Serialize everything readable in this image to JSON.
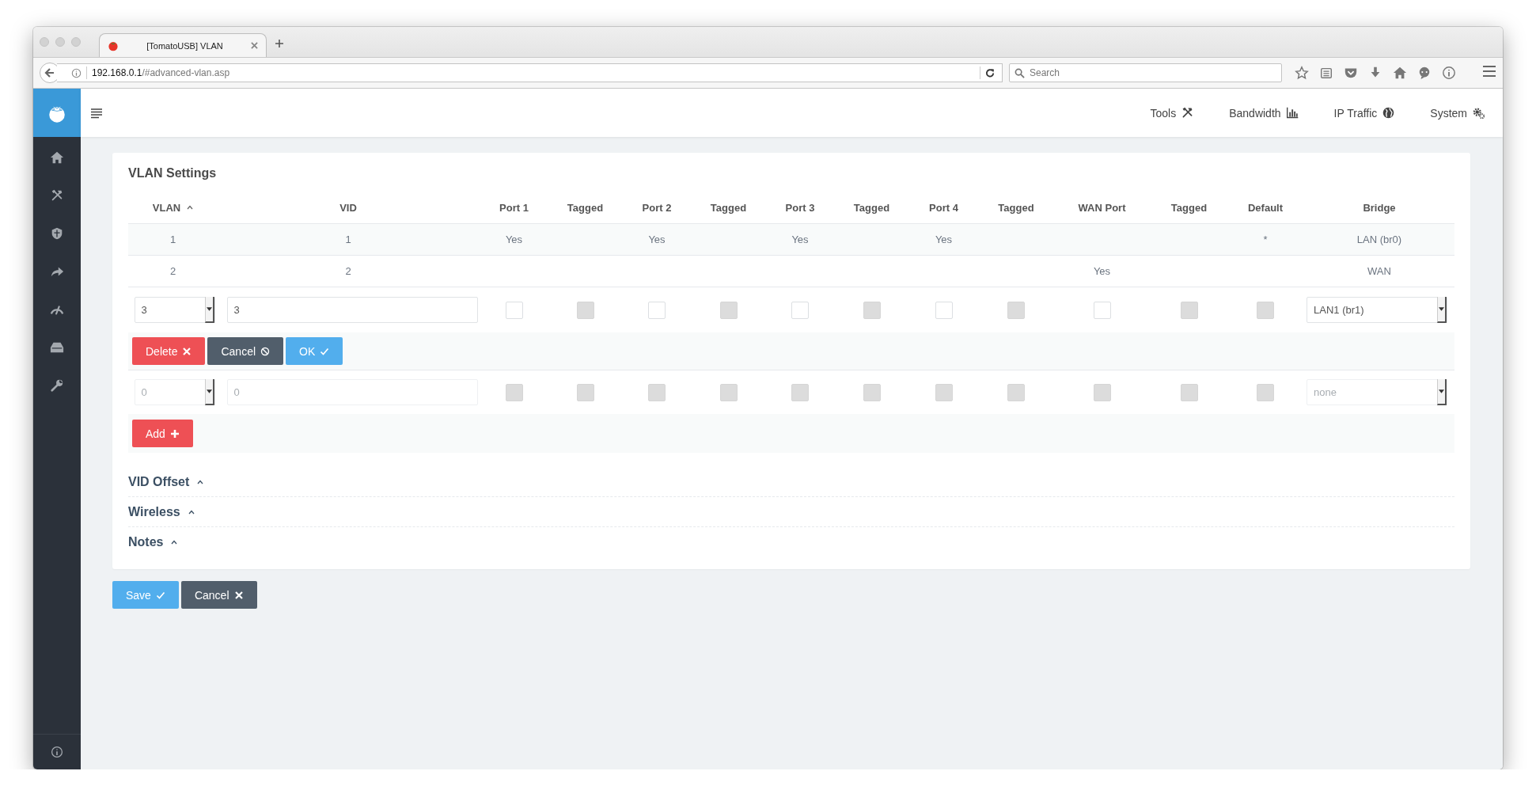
{
  "browser": {
    "tab_title": "[TomatoUSB] VLAN",
    "address": {
      "host": "192.168.0.1",
      "path": "/#advanced-vlan.asp"
    },
    "search": {
      "placeholder": "Search"
    }
  },
  "header": {
    "nav": [
      {
        "label": "Tools"
      },
      {
        "label": "Bandwidth"
      },
      {
        "label": "IP Traffic"
      },
      {
        "label": "System"
      }
    ]
  },
  "card": {
    "title": "VLAN Settings",
    "columns": [
      {
        "label": "VLAN",
        "sorted": true
      },
      {
        "label": "VID",
        "sorted": false
      },
      {
        "label": "Port 1",
        "sorted": false
      },
      {
        "label": "Tagged",
        "sorted": false
      },
      {
        "label": "Port 2",
        "sorted": false
      },
      {
        "label": "Tagged",
        "sorted": false
      },
      {
        "label": "Port 3",
        "sorted": false
      },
      {
        "label": "Tagged",
        "sorted": false
      },
      {
        "label": "Port 4",
        "sorted": false
      },
      {
        "label": "Tagged",
        "sorted": false
      },
      {
        "label": "WAN Port",
        "sorted": false
      },
      {
        "label": "Tagged",
        "sorted": false
      },
      {
        "label": "Default",
        "sorted": false
      },
      {
        "label": "Bridge",
        "sorted": false
      }
    ],
    "rows": [
      {
        "vlan": "1",
        "vid": "1",
        "port_1": "Yes",
        "port_2": "Yes",
        "port_3": "Yes",
        "port_4": "Yes",
        "default": "*",
        "bridge": "LAN (br0)"
      },
      {
        "vlan": "2",
        "vid": "2",
        "wan_port": "Yes",
        "bridge": "WAN"
      }
    ],
    "edit_row": {
      "disabled": false,
      "vlan": "3",
      "vid": "3",
      "bridge": "LAN1 (br1)",
      "checkboxes": [
        {
          "checked": false,
          "disabled": false
        },
        {
          "checked": false,
          "disabled": true
        },
        {
          "checked": false,
          "disabled": false
        },
        {
          "checked": false,
          "disabled": true
        },
        {
          "checked": false,
          "disabled": false
        },
        {
          "checked": false,
          "disabled": true
        },
        {
          "checked": false,
          "disabled": false
        },
        {
          "checked": false,
          "disabled": true
        },
        {
          "checked": false,
          "disabled": false
        },
        {
          "checked": false,
          "disabled": true
        },
        {
          "checked": false,
          "disabled": true
        }
      ]
    },
    "edit_buttons": [
      {
        "label": "Delete",
        "kind": "delete"
      },
      {
        "label": "Cancel",
        "kind": "cancel"
      },
      {
        "label": "OK",
        "kind": "ok"
      }
    ],
    "new_row": {
      "disabled": true,
      "vlan": "0",
      "vid": "0",
      "bridge": "none",
      "checkboxes": [
        {
          "checked": false,
          "disabled": true
        },
        {
          "checked": false,
          "disabled": true
        },
        {
          "checked": false,
          "disabled": true
        },
        {
          "checked": false,
          "disabled": true
        },
        {
          "checked": false,
          "disabled": true
        },
        {
          "checked": false,
          "disabled": true
        },
        {
          "checked": false,
          "disabled": true
        },
        {
          "checked": false,
          "disabled": true
        },
        {
          "checked": false,
          "disabled": true
        },
        {
          "checked": false,
          "disabled": true
        },
        {
          "checked": false,
          "disabled": true
        }
      ]
    },
    "new_buttons": [
      {
        "label": "Add",
        "kind": "add"
      }
    ],
    "sections": [
      {
        "title": "VID Offset",
        "expanded": false
      },
      {
        "title": "Wireless",
        "expanded": false
      },
      {
        "title": "Notes",
        "expanded": false
      }
    ]
  },
  "actions": [
    {
      "label": "Save",
      "kind": "save"
    },
    {
      "label": "Cancel",
      "kind": "discard"
    }
  ]
}
